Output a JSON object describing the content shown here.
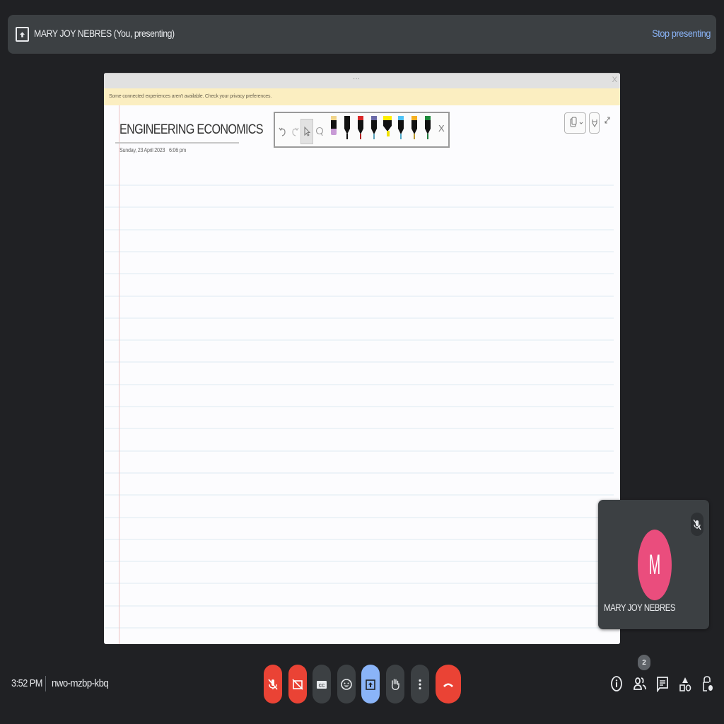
{
  "top_bar": {
    "presenter_label": "MARY JOY NEBRES (You, presenting)",
    "stop_presenting_label": "Stop presenting"
  },
  "shared_window": {
    "titlebar_dots": "···",
    "close_label": "X",
    "notice": "Some connected experiences aren't available. Check your privacy preferences.",
    "page_title": "ENGINEERING ECONOMICS",
    "page_date": "Sunday, 23 April 2023",
    "page_time": "6:06 pm",
    "ruled_line_count": 21,
    "pen_toolbar": {
      "tools": [
        "undo",
        "redo",
        "select",
        "lasso"
      ],
      "selected_tool": "select",
      "pens": [
        {
          "name": "pen-pink-eraser",
          "cap": "#f0d48a",
          "tip": "#c89ad6"
        },
        {
          "name": "pen-black",
          "cap": "#111111",
          "tip": "#111111"
        },
        {
          "name": "pen-red",
          "cap": "#d92828",
          "tip": "#b02020"
        },
        {
          "name": "pen-galaxy",
          "cap": "#6b6aa8",
          "tip": "#5aa0b8"
        },
        {
          "name": "highlighter-yellow",
          "cap": "#ffee00",
          "tip": "#f0e000"
        },
        {
          "name": "pen-light-blue",
          "cap": "#4fc3f7",
          "tip": "#4fa8c8"
        },
        {
          "name": "pen-gold",
          "cap": "#f5b022",
          "tip": "#b8962a"
        },
        {
          "name": "pen-green",
          "cap": "#1e8a3c",
          "tip": "#1e7a3c"
        }
      ],
      "close_label": "X"
    }
  },
  "self_tile": {
    "avatar_initial": "M",
    "avatar_color": "#ea4d7d",
    "name": "MARY JOY NEBRES"
  },
  "bottom_bar": {
    "time": "3:52 PM",
    "meeting_code": "nwo-mzbp-kbq",
    "controls": [
      {
        "name": "mic-off",
        "color": "#ea4335"
      },
      {
        "name": "camera-off",
        "color": "#ea4335"
      },
      {
        "name": "captions",
        "color": "#3c4043"
      },
      {
        "name": "emoji-reactions",
        "color": "#3c4043"
      },
      {
        "name": "present-now",
        "color": "#8ab4f8"
      },
      {
        "name": "raise-hand",
        "color": "#3c4043"
      },
      {
        "name": "more-options",
        "color": "#3c4043"
      },
      {
        "name": "leave-call",
        "color": "#ea4335"
      }
    ],
    "participants_count": "2"
  }
}
